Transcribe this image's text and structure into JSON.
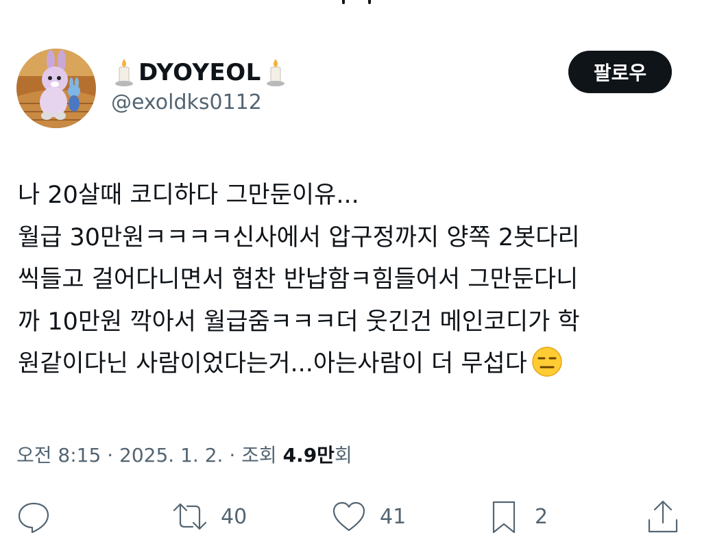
{
  "user": {
    "display_name": "DYOYEOL",
    "handle": "@exoldks0112",
    "follow_label": "팔로우"
  },
  "tweet": {
    "lines": [
      "나  20살때 코디하다 그만둔이유...",
      "월급 30만원ㅋㅋㅋㅋ신사에서 압구정까지 양쪽 2봇다리",
      "씩들고 걸어다니면서 협찬 반납함ㅋ힘들어서 그만둔다니",
      "까 10만원 깍아서 월급줌ㅋㅋㅋ더 웃긴건 메인코디가 학",
      "원같이다닌 사람이었다는거...아는사람이 더 무섭다"
    ],
    "emoji": "expressionless-face-emoji"
  },
  "meta": {
    "time": "오전 8:15",
    "sep": "·",
    "date": "2025. 1. 2.",
    "views_label": "조회",
    "views_count": "4.9만",
    "views_suffix": "회"
  },
  "actions": {
    "reply_icon": "reply-icon",
    "retweet_count": "40",
    "like_count": "41",
    "bookmark_count": "2",
    "share_icon": "share-icon"
  },
  "colors": {
    "text": "#0f1419",
    "secondary": "#536471",
    "button_bg": "#0f1419",
    "button_text": "#ffffff"
  }
}
